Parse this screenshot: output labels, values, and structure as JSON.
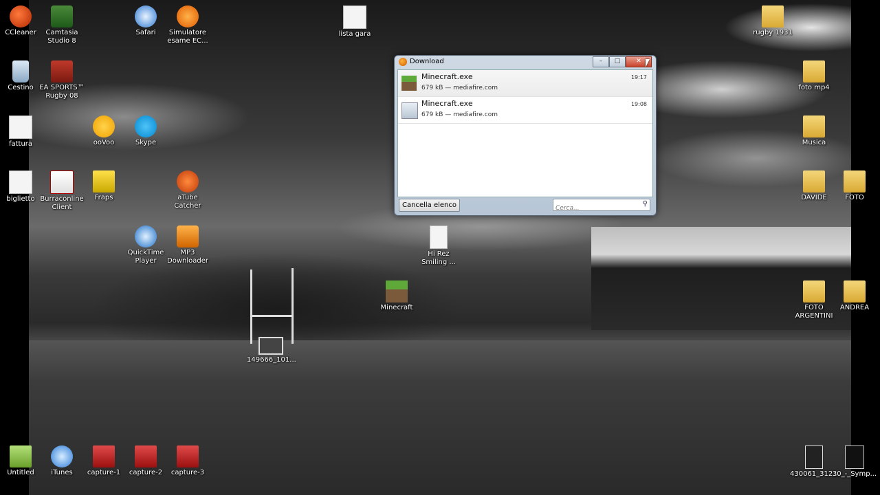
{
  "desktop_icons": [
    {
      "label": "CCleaner",
      "icon": "ccleaner-icon"
    },
    {
      "label": "Camtasia\nStudio 8",
      "icon": "camtasia-icon"
    },
    {
      "label": "Safari",
      "icon": "safari-icon"
    },
    {
      "label": "Simulatore\nesame EC...",
      "icon": "simulator-icon"
    },
    {
      "label": "lista gara",
      "icon": "document-icon"
    },
    {
      "label": "rugby 1931",
      "icon": "folder-icon"
    },
    {
      "label": "Cestino",
      "icon": "recycle-bin-icon"
    },
    {
      "label": "EA SPORTS™\nRugby 08",
      "icon": "ea-rugby-icon"
    },
    {
      "label": "foto mp4",
      "icon": "folder-icon"
    },
    {
      "label": "fattura",
      "icon": "document-icon"
    },
    {
      "label": "ooVoo",
      "icon": "oovoo-icon"
    },
    {
      "label": "Skype",
      "icon": "skype-icon"
    },
    {
      "label": "Musica",
      "icon": "folder-icon"
    },
    {
      "label": "biglietto",
      "icon": "document-icon"
    },
    {
      "label": "Burraconline\nClient",
      "icon": "burraco-icon"
    },
    {
      "label": "Fraps",
      "icon": "fraps-icon"
    },
    {
      "label": "aTube\nCatcher",
      "icon": "atube-icon"
    },
    {
      "label": "DAVIDE",
      "icon": "folder-icon"
    },
    {
      "label": "FOTO",
      "icon": "folder-icon"
    },
    {
      "label": "QuickTime\nPlayer",
      "icon": "quicktime-icon"
    },
    {
      "label": "MP3\nDownloader",
      "icon": "mp3-downloader-icon"
    },
    {
      "label": "Hi Rez\nSmiling ...",
      "icon": "mp3-file-icon"
    },
    {
      "label": "Minecraft",
      "icon": "minecraft-icon"
    },
    {
      "label": "FOTO\nARGENTINI",
      "icon": "folder-icon"
    },
    {
      "label": "ANDREA",
      "icon": "folder-icon"
    },
    {
      "label": "149666_101...",
      "icon": "image-file-icon"
    },
    {
      "label": "Untitled",
      "icon": "untitled-icon"
    },
    {
      "label": "iTunes",
      "icon": "itunes-icon"
    },
    {
      "label": "capture-1",
      "icon": "video-file-icon"
    },
    {
      "label": "capture-2",
      "icon": "video-file-icon"
    },
    {
      "label": "capture-3",
      "icon": "video-file-icon"
    },
    {
      "label": "430061_312...",
      "icon": "image-file-icon"
    },
    {
      "label": "30_-_Symp...",
      "icon": "music-file-icon"
    }
  ],
  "download_window": {
    "title": "Download",
    "buttons": {
      "minimize": "–",
      "maximize": "□",
      "close": "✕"
    },
    "items": [
      {
        "name": "Minecraft.exe",
        "info": "679 kB — mediafire.com",
        "time": "19:17",
        "icon": "minecraft-icon"
      },
      {
        "name": "Minecraft.exe",
        "info": "679 kB — mediafire.com",
        "time": "19:08",
        "icon": "exe-icon"
      }
    ],
    "clear_button": "Cancella elenco",
    "search_placeholder": "Cerca..."
  },
  "colors": {
    "close_button": "#c7432a",
    "window_frame": "#cfd9e4"
  }
}
